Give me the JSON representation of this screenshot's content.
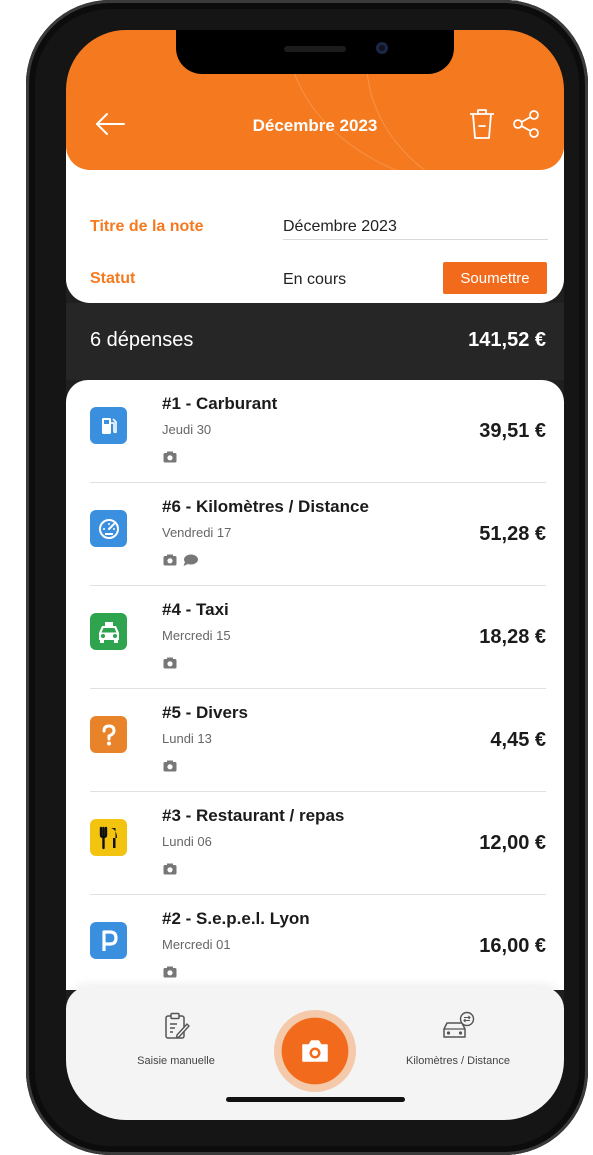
{
  "header": {
    "title": "Décembre 2023",
    "accent_color": "#f57a1f",
    "back_icon": "arrow-left-icon",
    "delete_icon": "trash-icon",
    "share_icon": "share-icon"
  },
  "note": {
    "title_label": "Titre de la note",
    "title_value": "Décembre 2023",
    "status_label": "Statut",
    "status_value": "En cours",
    "submit_label": "Soumettre"
  },
  "summary": {
    "count_label": "6 dépenses",
    "total": "141,52 €"
  },
  "expenses": [
    {
      "title": "#1 - Carburant",
      "date": "Jeudi 30",
      "amount": "39,51 €",
      "icon": "fuel-pump-icon",
      "icon_color": "#3a8fde",
      "has_photo": true,
      "has_comment": false
    },
    {
      "title": "#6 - Kilomètres / Distance",
      "date": "Vendredi 17",
      "amount": "51,28 €",
      "icon": "speedometer-icon",
      "icon_color": "#3a8fde",
      "has_photo": true,
      "has_comment": true
    },
    {
      "title": "#4 - Taxi",
      "date": "Mercredi 15",
      "amount": "18,28 €",
      "icon": "taxi-icon",
      "icon_color": "#2ea44f",
      "has_photo": true,
      "has_comment": false
    },
    {
      "title": "#5 - Divers",
      "date": "Lundi 13",
      "amount": "4,45 €",
      "icon": "question-mark-icon",
      "icon_color": "#e8832a",
      "has_photo": true,
      "has_comment": false
    },
    {
      "title": "#3 - Restaurant / repas",
      "date": "Lundi 06",
      "amount": "12,00 €",
      "icon": "fork-knife-icon",
      "icon_color": "#f2c40f",
      "has_photo": true,
      "has_comment": false
    },
    {
      "title": "#2 - S.e.p.e.l. Lyon",
      "date": "Mercredi 01",
      "amount": "16,00 €",
      "icon": "parking-icon",
      "icon_color": "#3a8fde",
      "has_photo": true,
      "has_comment": false
    }
  ],
  "dock": {
    "manual_label": "Saisie manuelle",
    "distance_label": "Kilomètres / Distance",
    "camera_icon": "camera-icon"
  }
}
